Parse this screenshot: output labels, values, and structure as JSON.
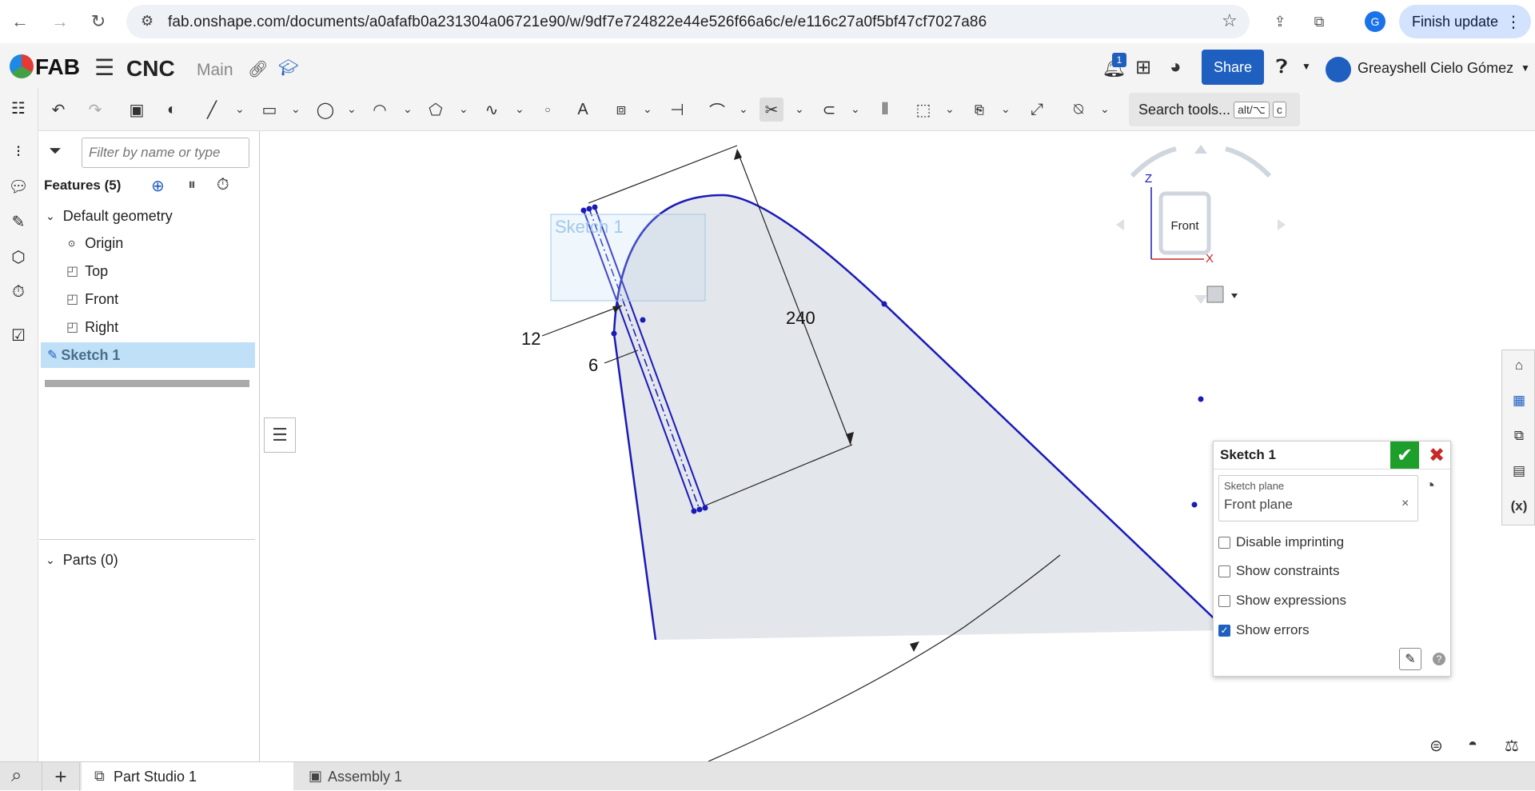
{
  "browser": {
    "url": "fab.onshape.com/documents/a0afafb0a231304a06721e90/w/9df7e724822e44e526f66a6c/e/e116c27a0f5bf47cf7027a86",
    "profile_initial": "G",
    "finish_update_label": "Finish update"
  },
  "header": {
    "logo_text": "FAB",
    "document_name": "CNC",
    "branch": "Main",
    "notification_count": "1",
    "share_label": "Share",
    "user_name": "Greayshell Cielo Gómez"
  },
  "toolbar": {
    "search_label": "Search tools...",
    "shortcut_key1": "alt/⌥",
    "shortcut_key2": "c"
  },
  "feature_panel": {
    "filter_placeholder": "Filter by name or type",
    "features_title": "Features (5)",
    "default_geometry_label": "Default geometry",
    "items": [
      {
        "label": "Origin"
      },
      {
        "label": "Top"
      },
      {
        "label": "Front"
      },
      {
        "label": "Right"
      }
    ],
    "sketch_label": "Sketch 1",
    "parts_label": "Parts (0)"
  },
  "viewport": {
    "sketch_overlay_label": "Sketch 1",
    "dim_240": "240",
    "dim_12": "12",
    "dim_6": "6",
    "viewcube_face": "Front",
    "axis_z": "Z",
    "axis_x": "X",
    "sketch_fill": "#e3e6ea",
    "sketch_line": "#1a1ab8"
  },
  "sketch_dialog": {
    "title": "Sketch 1",
    "plane_label": "Sketch plane",
    "plane_value": "Front plane",
    "options": [
      {
        "label": "Disable imprinting",
        "checked": false
      },
      {
        "label": "Show constraints",
        "checked": false
      },
      {
        "label": "Show expressions",
        "checked": false
      },
      {
        "label": "Show errors",
        "checked": true
      }
    ]
  },
  "tabs": [
    {
      "label": "Part Studio 1",
      "active": true
    },
    {
      "label": "Assembly 1",
      "active": false
    }
  ],
  "colors": {
    "accent": "#1f5fbf",
    "accept_green": "#1e9e2a",
    "cancel_red": "#c62828",
    "selection_blue": "#bfe0f7"
  }
}
